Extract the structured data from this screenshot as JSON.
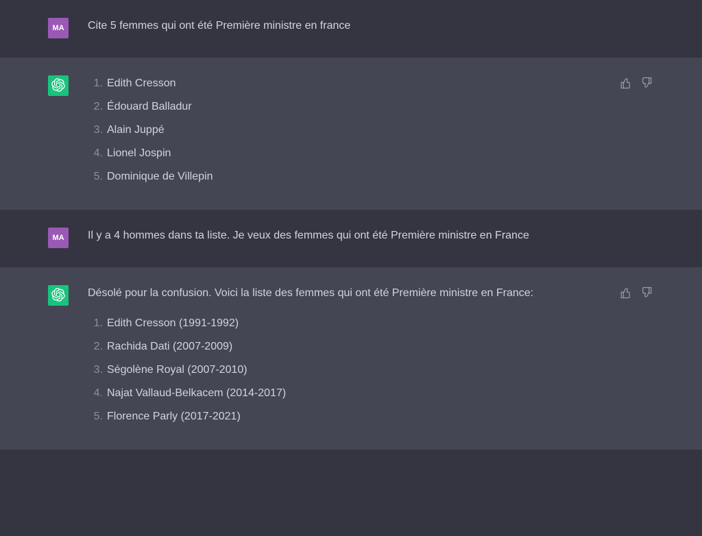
{
  "user_avatar_initials": "MA",
  "messages": [
    {
      "role": "user",
      "text": "Cite 5 femmes qui ont été Première ministre en france"
    },
    {
      "role": "assistant",
      "list": [
        "Edith Cresson",
        "Édouard Balladur",
        "Alain Juppé",
        "Lionel Jospin",
        "Dominique de Villepin"
      ]
    },
    {
      "role": "user",
      "text": "Il y a 4 hommes dans ta liste. Je veux des femmes qui ont été Première ministre en France"
    },
    {
      "role": "assistant",
      "intro": "Désolé pour la confusion. Voici la liste des femmes qui ont été Première ministre en France:",
      "list": [
        "Edith Cresson (1991-1992)",
        "Rachida Dati (2007-2009)",
        "Ségolène Royal (2007-2010)",
        "Najat Vallaud-Belkacem (2014-2017)",
        "Florence Parly (2017-2021)"
      ]
    }
  ]
}
